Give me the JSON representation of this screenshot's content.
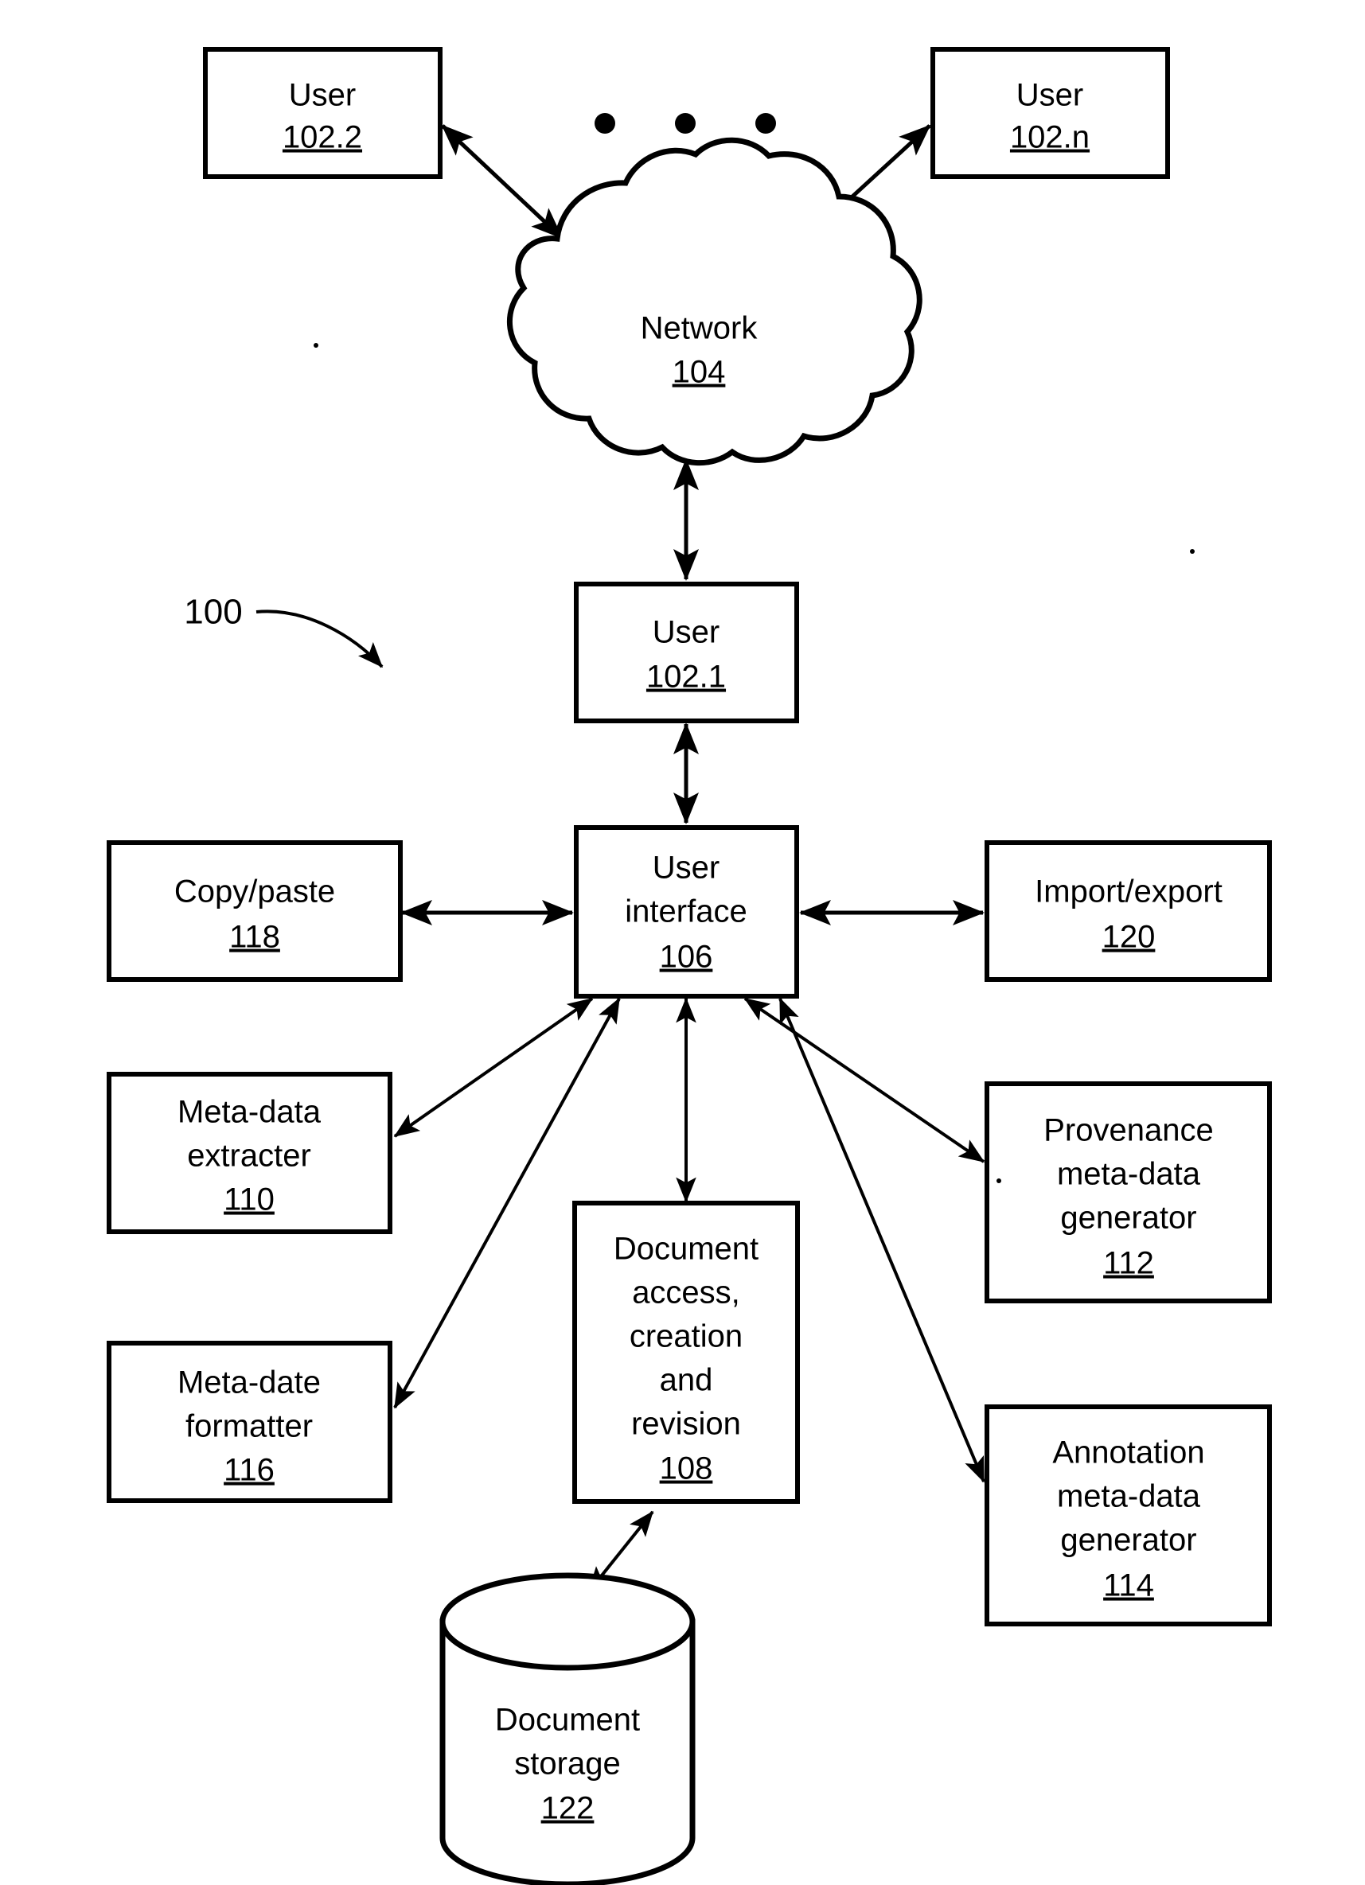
{
  "figure": {
    "label": "100",
    "nodes": {
      "user_102_2": {
        "title": "User",
        "ref": "102.2"
      },
      "user_102_n": {
        "title": "User",
        "ref": "102.n"
      },
      "network": {
        "title": "Network",
        "ref": "104"
      },
      "user_102_1": {
        "title": "User",
        "ref": "102.1"
      },
      "user_interface": {
        "line1": "User",
        "line2": "interface",
        "ref": "106"
      },
      "copy_paste": {
        "title": "Copy/paste",
        "ref": "118"
      },
      "import_export": {
        "title": "Import/export",
        "ref": "120"
      },
      "metadata_extracter": {
        "line1": "Meta-data",
        "line2": "extracter",
        "ref": "110"
      },
      "provenance_generator": {
        "line1": "Provenance",
        "line2": "meta-data",
        "line3": "generator",
        "ref": "112"
      },
      "metadate_formatter": {
        "line1": "Meta-date",
        "line2": "formatter",
        "ref": "116"
      },
      "document_access": {
        "line1": "Document",
        "line2": "access,",
        "line3": "creation",
        "line4": "and",
        "line5": "revision",
        "ref": "108"
      },
      "annotation_generator": {
        "line1": "Annotation",
        "line2": "meta-data",
        "line3": "generator",
        "ref": "114"
      },
      "document_storage": {
        "line1": "Document",
        "line2": "storage",
        "ref": "122"
      }
    },
    "ellipsis": "• • •",
    "colors": {
      "stroke": "#000000",
      "fill": "#ffffff",
      "background": "#ffffff"
    }
  }
}
